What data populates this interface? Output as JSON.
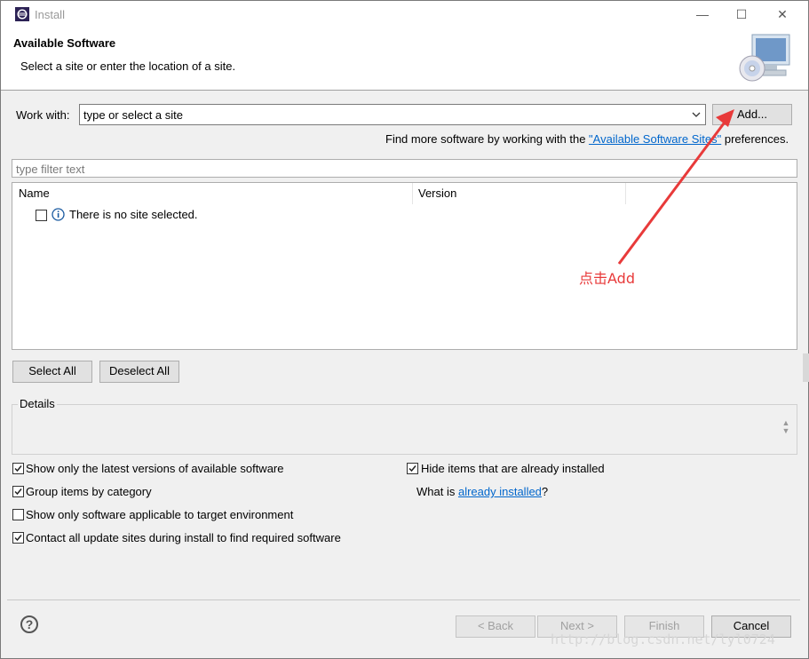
{
  "window": {
    "title": "Install",
    "icon": "eclipse-icon"
  },
  "header": {
    "title": "Available Software",
    "subtitle": "Select a site or enter the location of a site.",
    "banner_icon": "cd-computer-icon"
  },
  "work_with": {
    "label": "Work with:",
    "value": "type or select a site",
    "add_label": "Add..."
  },
  "find_more": {
    "prefix": "Find more software by working with the ",
    "link": "\"Available Software Sites\"",
    "suffix": " preferences."
  },
  "filter": {
    "placeholder": "type filter text"
  },
  "table": {
    "columns": [
      "Name",
      "Version"
    ],
    "empty_message": "There is no site selected."
  },
  "buttons": {
    "select_all": "Select All",
    "deselect_all": "Deselect All"
  },
  "details": {
    "title": "Details"
  },
  "options": {
    "latest_versions": {
      "label": "Show only the latest versions of available software",
      "checked": true
    },
    "group_by_category": {
      "label": "Group items by category",
      "checked": true
    },
    "target_env": {
      "label": "Show only software applicable to target environment",
      "checked": false
    },
    "contact_sites": {
      "label": "Contact all update sites during install to find required software",
      "checked": true
    },
    "hide_installed": {
      "label": "Hide items that are already installed",
      "checked": true
    },
    "what_is": {
      "prefix": "What is ",
      "link": "already installed",
      "suffix": "?"
    }
  },
  "footer": {
    "back": "< Back",
    "next": "Next >",
    "finish": "Finish",
    "cancel": "Cancel"
  },
  "annotation": {
    "text": "点击Add",
    "color": "#e83a3a"
  },
  "watermark": "http://blog.csdn.net/lyl0724"
}
